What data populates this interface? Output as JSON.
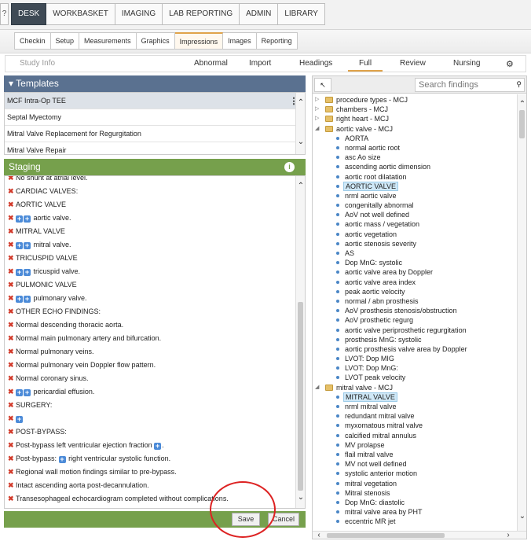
{
  "topnav": {
    "help": "?",
    "tabs": [
      "DESK",
      "WORKBASKET",
      "IMAGING",
      "LAB REPORTING",
      "ADMIN",
      "LIBRARY"
    ]
  },
  "subnav": {
    "tabs": [
      "Checkin",
      "Setup",
      "Measurements",
      "Graphics",
      "Impressions",
      "Images",
      "Reporting"
    ]
  },
  "tertiary": {
    "study_info": "Study Info",
    "tabs": [
      "Abnormal",
      "Import",
      "Headings",
      "Full",
      "Review",
      "Nursing"
    ]
  },
  "templates": {
    "title": "Templates",
    "items": [
      "MCF Intra-Op TEE",
      "Septal Myectomy",
      "Mitral Valve Replacement for Regurgitation",
      "Mitral Valve Repair"
    ]
  },
  "staging": {
    "title": "Staging",
    "rows": [
      "No shunt at atrial level.",
      "CARDIAC VALVES:",
      "AORTIC VALVE",
      "aortic valve.",
      "MITRAL VALVE",
      "mitral valve.",
      "TRICUSPID VALVE",
      "tricuspid valve.",
      "PULMONIC VALVE",
      "pulmonary valve.",
      "OTHER ECHO FINDINGS:",
      "Normal descending thoracic aorta.",
      "Normal main pulmonary artery and bifurcation.",
      "Normal pulmonary veins.",
      "Normal pulmonary vein Doppler flow pattern.",
      "Normal coronary sinus.",
      "pericardial effusion.",
      "SURGERY:",
      "",
      "POST-BYPASS:",
      "Post-bypass left ventricular ejection fraction",
      "right ventricular systolic function.",
      "Regional wall motion findings similar to pre-bypass.",
      "Intact ascending aorta post-decannulation.",
      "Transesophageal echocardiogram completed without complications."
    ],
    "row_21_prefix": "Post-bypass:",
    "save": "Save",
    "cancel": "Cancel"
  },
  "findings": {
    "search_placeholder": "Search findings",
    "tree": [
      "procedure types - MCJ",
      "chambers - MCJ",
      "right heart - MCJ",
      "aortic valve - MCJ",
      "AORTA",
      "normal aortic root",
      "asc Ao size",
      "ascending aortic dimension",
      "aortic root dilatation",
      "AORTIC VALVE",
      "nrml aortic valve",
      "congenitally abnormal",
      "AoV not well defined",
      "aortic mass / vegetation",
      "aortic vegetation",
      "aortic stenosis severity",
      "AS",
      "Dop MnG: systolic",
      "aortic valve area by Doppler",
      "aortic valve area index",
      "peak aortic velocity",
      "normal / abn prosthesis",
      "AoV prosthesis stenosis/obstruction",
      "AoV prosthetic regurg",
      "aortic valve periprosthetic regurgitation",
      "prosthesis MnG: systolic",
      "aortic prosthesis valve area by Doppler",
      "LVOT: Dop MIG",
      "LVOT: Dop MnG:",
      "LVOT peak velocity",
      "mitral valve - MCJ",
      "MITRAL VALVE",
      "nrml mitral valve",
      "redundant mitral valve",
      "myxomatous mitral valve",
      "calcified mitral annulus",
      "MV prolapse",
      "flail mitral valve",
      "MV not well defined",
      "systolic anterior motion",
      "mitral vegetation",
      "Mitral stenosis",
      "Dop MnG: diastolic",
      "mitral valve area by PHT",
      "eccentric MR jet"
    ]
  }
}
